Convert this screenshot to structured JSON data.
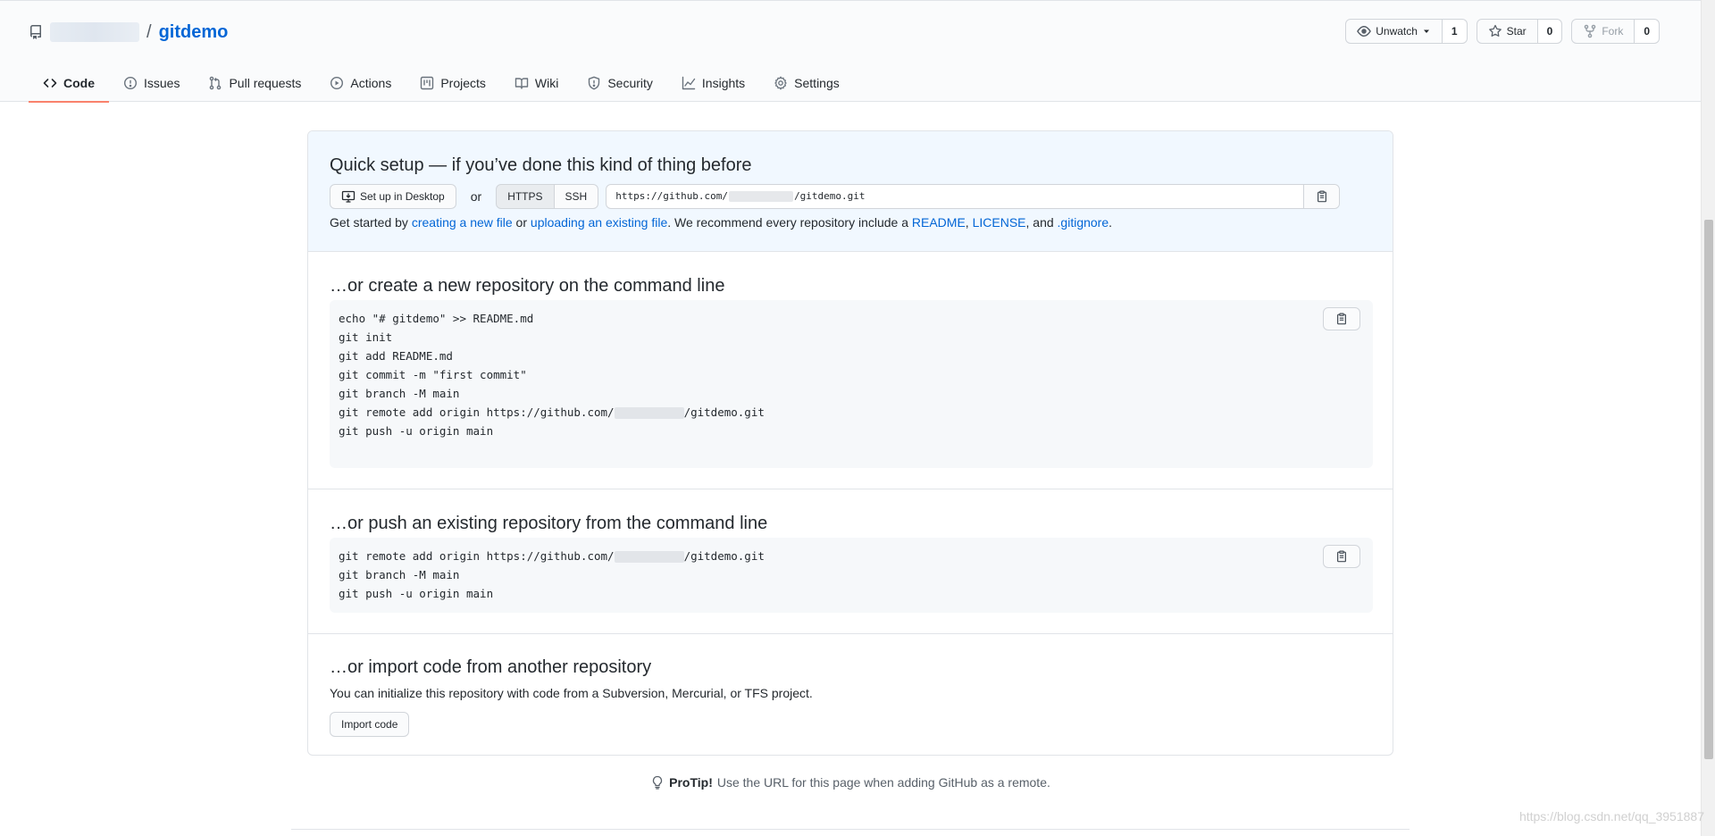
{
  "repo": {
    "name": "gitdemo",
    "slash": "/"
  },
  "actions": {
    "watch_label": "Unwatch",
    "watch_count": "1",
    "star_label": "Star",
    "star_count": "0",
    "fork_label": "Fork",
    "fork_count": "0"
  },
  "tabs": [
    {
      "label": "Code",
      "icon": "code-icon",
      "selected": true
    },
    {
      "label": "Issues",
      "icon": "issue-icon"
    },
    {
      "label": "Pull requests",
      "icon": "pull-request-icon"
    },
    {
      "label": "Actions",
      "icon": "play-icon"
    },
    {
      "label": "Projects",
      "icon": "project-icon"
    },
    {
      "label": "Wiki",
      "icon": "book-icon"
    },
    {
      "label": "Security",
      "icon": "shield-icon"
    },
    {
      "label": "Insights",
      "icon": "graph-icon"
    },
    {
      "label": "Settings",
      "icon": "gear-icon"
    }
  ],
  "quick_setup": {
    "title": "Quick setup — if you’ve done this kind of thing before",
    "desktop_button": "Set up in Desktop",
    "or": "or",
    "https_label": "HTTPS",
    "ssh_label": "SSH",
    "url_prefix": "https://github.com/",
    "url_suffix": "/gitdemo.git",
    "get_started": {
      "p1": "Get started by ",
      "link1": "creating a new file",
      "p2": " or ",
      "link2": "uploading an existing file",
      "p3": ". We recommend every repository include a ",
      "link3": "README",
      "p4": ", ",
      "link4": "LICENSE",
      "p5": ", and ",
      "link5": ".gitignore",
      "p6": "."
    }
  },
  "create_section": {
    "title": "…or create a new repository on the command line",
    "lines": {
      "l1": "echo \"# gitdemo\" >> README.md",
      "l2": "git init",
      "l3": "git add README.md",
      "l4": "git commit -m \"first commit\"",
      "l5": "git branch -M main",
      "l6_prefix": "git remote add origin https://github.com/",
      "l6_suffix": "/gitdemo.git",
      "l7": "git push -u origin main"
    }
  },
  "push_section": {
    "title": "…or push an existing repository from the command line",
    "lines": {
      "l1_prefix": "git remote add origin https://github.com/",
      "l1_suffix": "/gitdemo.git",
      "l2": "git branch -M main",
      "l3": "git push -u origin main"
    }
  },
  "import_section": {
    "title": "…or import code from another repository",
    "description": "You can initialize this repository with code from a Subversion, Mercurial, or TFS project.",
    "button": "Import code"
  },
  "protip": {
    "bold": "ProTip!",
    "text": " Use the URL for this page when adding GitHub as a remote."
  },
  "watermark": "https://blog.csdn.net/qq_3951887"
}
